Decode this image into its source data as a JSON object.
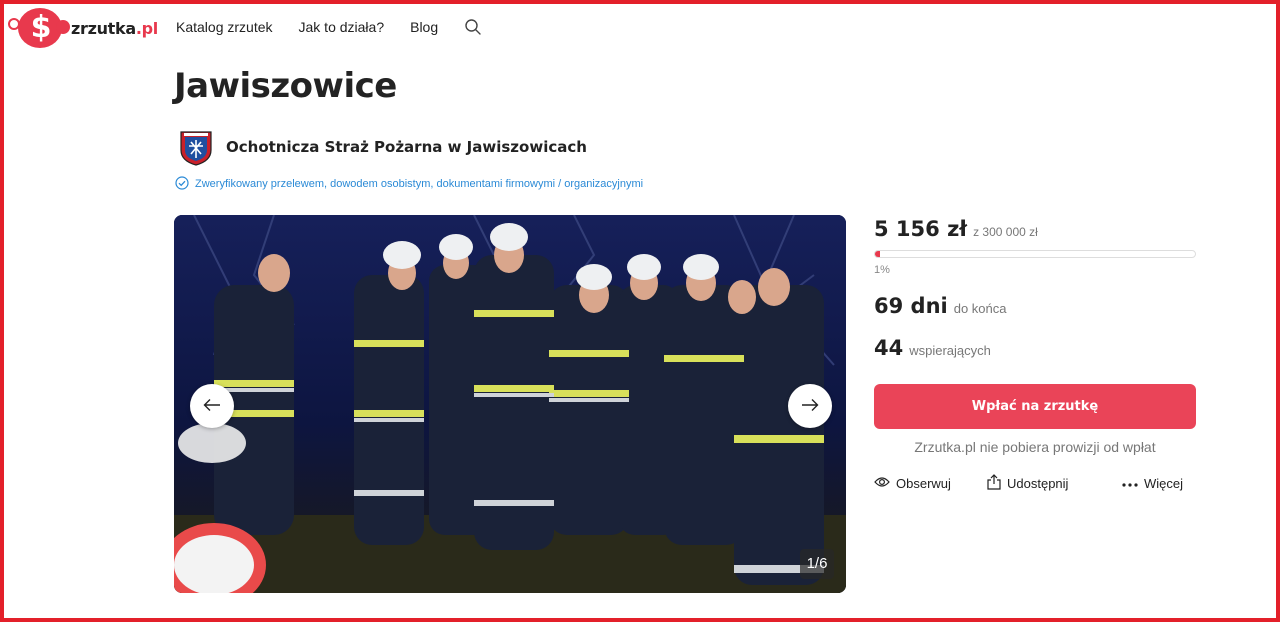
{
  "brand": {
    "name": "zrzutka",
    "tld": ".pl",
    "accent": "#e8394d"
  },
  "nav": {
    "items": [
      {
        "label": "Katalog zrzutek"
      },
      {
        "label": "Jak to działa?"
      },
      {
        "label": "Blog"
      }
    ],
    "search_icon": "search-icon"
  },
  "campaign": {
    "title": "Jawiszowice",
    "organizer": "Ochotnicza Straż Pożarna w Jawiszowicach",
    "verified_text": "Zweryfikowany przelewem, dowodem osobistym, dokumentami firmowymi / organizacyjnymi"
  },
  "gallery": {
    "counter": "1/6",
    "current": 1,
    "total": 6,
    "prev_icon": "arrow-left-icon",
    "next_icon": "arrow-right-icon"
  },
  "funding": {
    "raised": "5 156 zł",
    "goal": "z 300 000 zł",
    "percent_label": "1%",
    "progress_fraction": 0.017,
    "days_value": "69 dni",
    "days_label": "do końca",
    "supporters_value": "44",
    "supporters_label": "wspierających",
    "pay_button": "Wpłać na zrzutkę",
    "no_fee_note": "Zrzutka.pl nie pobiera prowizji od wpłat",
    "button_color": "#ea4458"
  },
  "actions": {
    "watch": "Obserwuj",
    "share": "Udostępnij",
    "more": "Więcej"
  }
}
